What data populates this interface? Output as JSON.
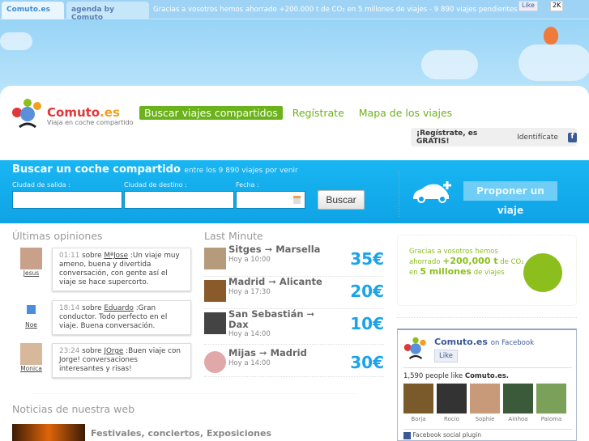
{
  "topbar": {
    "tab1": "Comuto.es",
    "tab2": "agenda by Comuto",
    "message": "Gracias a vosotros hemos ahorrado +200.000 t de CO₂ en 5 millones de viajes - 9 890 viajes pendientes",
    "like": "Like",
    "like_count": "2K"
  },
  "header": {
    "brand": "Comuto",
    "brand_tld": ".es",
    "tagline": "Viaja en coche compartido",
    "nav": [
      "Buscar viajes compartidos",
      "Regístrate",
      "Mapa de los viajes"
    ],
    "register": "¡Regístrate, es GRATIS!",
    "login": "Identifícate"
  },
  "search": {
    "title": "Buscar un coche compartido",
    "subtitle": "entre los 9 890 viajes por venir",
    "from_label": "Ciudad de salida :",
    "to_label": "Ciudad de destino :",
    "date_label": "Fecha :",
    "button": "Buscar",
    "propose": "Proponer un viaje"
  },
  "opinions": {
    "title": "Últimas opiniones",
    "items": [
      {
        "user": "Jesus",
        "time": "01:11",
        "about": "sobre",
        "target": "MªJose",
        "text": ":Un viaje muy ameno, buena y divertida conversación, con gente así el viaje se hace supercorto."
      },
      {
        "user": "Noe",
        "time": "18:14",
        "about": "sobre",
        "target": "Eduardo",
        "text": ":Gran conductor. Todo perfecto en el viaje. Buena conversación."
      },
      {
        "user": "Monica",
        "time": "23:24",
        "about": "sobre",
        "target": "JOrge",
        "text": ":Buen viaje con Jorge! conversaciones interesantes y risas!"
      }
    ]
  },
  "last_minute": {
    "title": "Last Minute",
    "items": [
      {
        "route": "Sitges ➞ Marsella",
        "time": "Hoy a 10:00",
        "price": "35€"
      },
      {
        "route": "Madrid ➞ Alicante",
        "time": "Hoy a 17:30",
        "price": "20€"
      },
      {
        "route": "San Sebastián ➞ Dax",
        "time": "Hoy a 14:00",
        "price": "10€"
      },
      {
        "route": "Mijas ➞ Madrid",
        "time": "Hoy a 14:00",
        "price": "30€"
      }
    ]
  },
  "co2": {
    "l1": "Gracias a vosotros hemos",
    "l2a": "ahorrado",
    "l2b": "+200,000 t",
    "l2c": "de CO₂",
    "l3a": "en",
    "l3b": "5 millones",
    "l3c": "de viajes"
  },
  "facebook": {
    "page": "Comuto.es",
    "on": "on Facebook",
    "like": "Like",
    "count_text": "1,590 people like",
    "count_page": "Comuto.es.",
    "faces": [
      "Borja",
      "Rocio",
      "Sophie",
      "Ainhoa",
      "Paloma"
    ],
    "footer": "Facebook social plugin"
  },
  "news": {
    "title": "Noticias de nuestra web",
    "item": "Festivales, conciertos, Exposiciones"
  }
}
